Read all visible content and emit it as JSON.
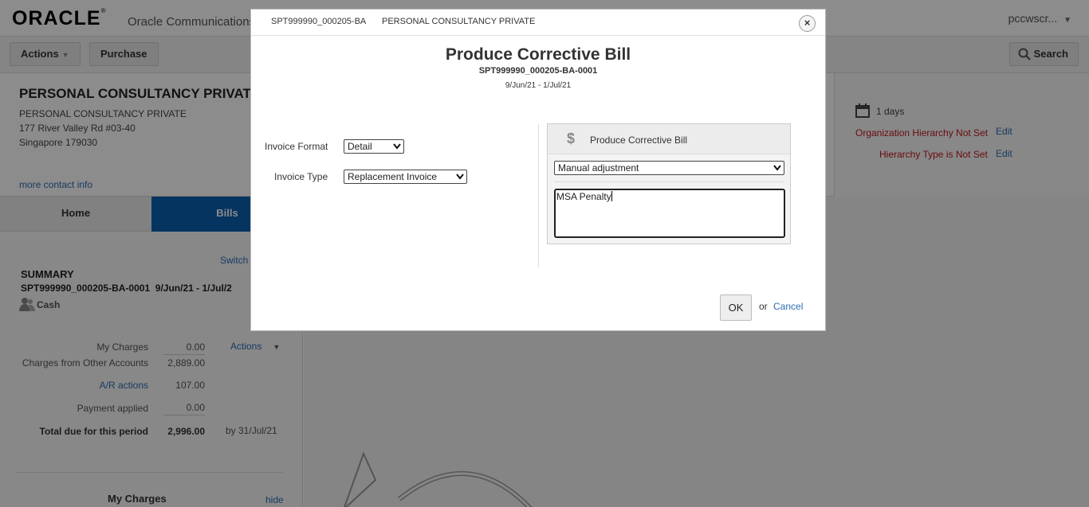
{
  "app": {
    "logo": "ORACLE",
    "logo_mark": "®",
    "product": "Oracle Communications",
    "user": "pccwscr..."
  },
  "toolbar": {
    "actions_label": "Actions",
    "purchase_label": "Purchase",
    "search_label": "Search"
  },
  "account": {
    "title": "PERSONAL CONSULTANCY PRIVATE",
    "name_line": "PERSONAL CONSULTANCY PRIVATE",
    "address1": "177 River Valley Rd #03-40",
    "address2": "Singapore 179030",
    "more_contact": "more contact info",
    "days": "1 days",
    "org_warning": "Organization Hierarchy Not Set",
    "hier_warning": "Hierarchy Type is Not Set",
    "edit_label": "Edit"
  },
  "tabs": [
    {
      "label": "Home"
    },
    {
      "label": "Bills"
    }
  ],
  "summary": {
    "switch": "Switch",
    "title": "SUMMARY",
    "bill_id": "SPT999990_000205-BA-0001",
    "period": "9/Jun/21 - 1/Jul/2",
    "payment_type": "Cash",
    "actions": "Actions",
    "rows": [
      {
        "label": "My Charges",
        "value": "0.00"
      },
      {
        "label": "Charges from Other Accounts",
        "value": "2,889.00"
      },
      {
        "label": "A/R actions",
        "value": "107.00"
      },
      {
        "label": "Payment applied",
        "value": "0.00"
      },
      {
        "label": "Total due for this period",
        "value": "2,996.00"
      }
    ],
    "due_by": "by  31/Jul/21",
    "my_charges_header": "My Charges",
    "hide": "hide"
  },
  "dialog": {
    "account_id": "SPT999990_000205-BA",
    "account_name": "PERSONAL CONSULTANCY PRIVATE",
    "close_symbol": "×",
    "title": "Produce Corrective Bill",
    "bill_id": "SPT999990_000205-BA-0001",
    "period": "9/Jun/21 - 1/Jul/21",
    "invoice_format_label": "Invoice Format",
    "invoice_format_value": "Detail",
    "invoice_type_label": "Invoice Type",
    "invoice_type_value": "Replacement Invoice",
    "panel_title": "Produce Corrective Bill",
    "panel_icon": "$",
    "reason_value": "Manual adjustment",
    "comment_value": "MSA Penalty",
    "ok_label": "OK",
    "or_label": "or",
    "cancel_label": "Cancel"
  },
  "colors": {
    "accent_blue": "#0a5fb0",
    "link_blue": "#2a6cb2",
    "warning_red": "#c0171d"
  }
}
